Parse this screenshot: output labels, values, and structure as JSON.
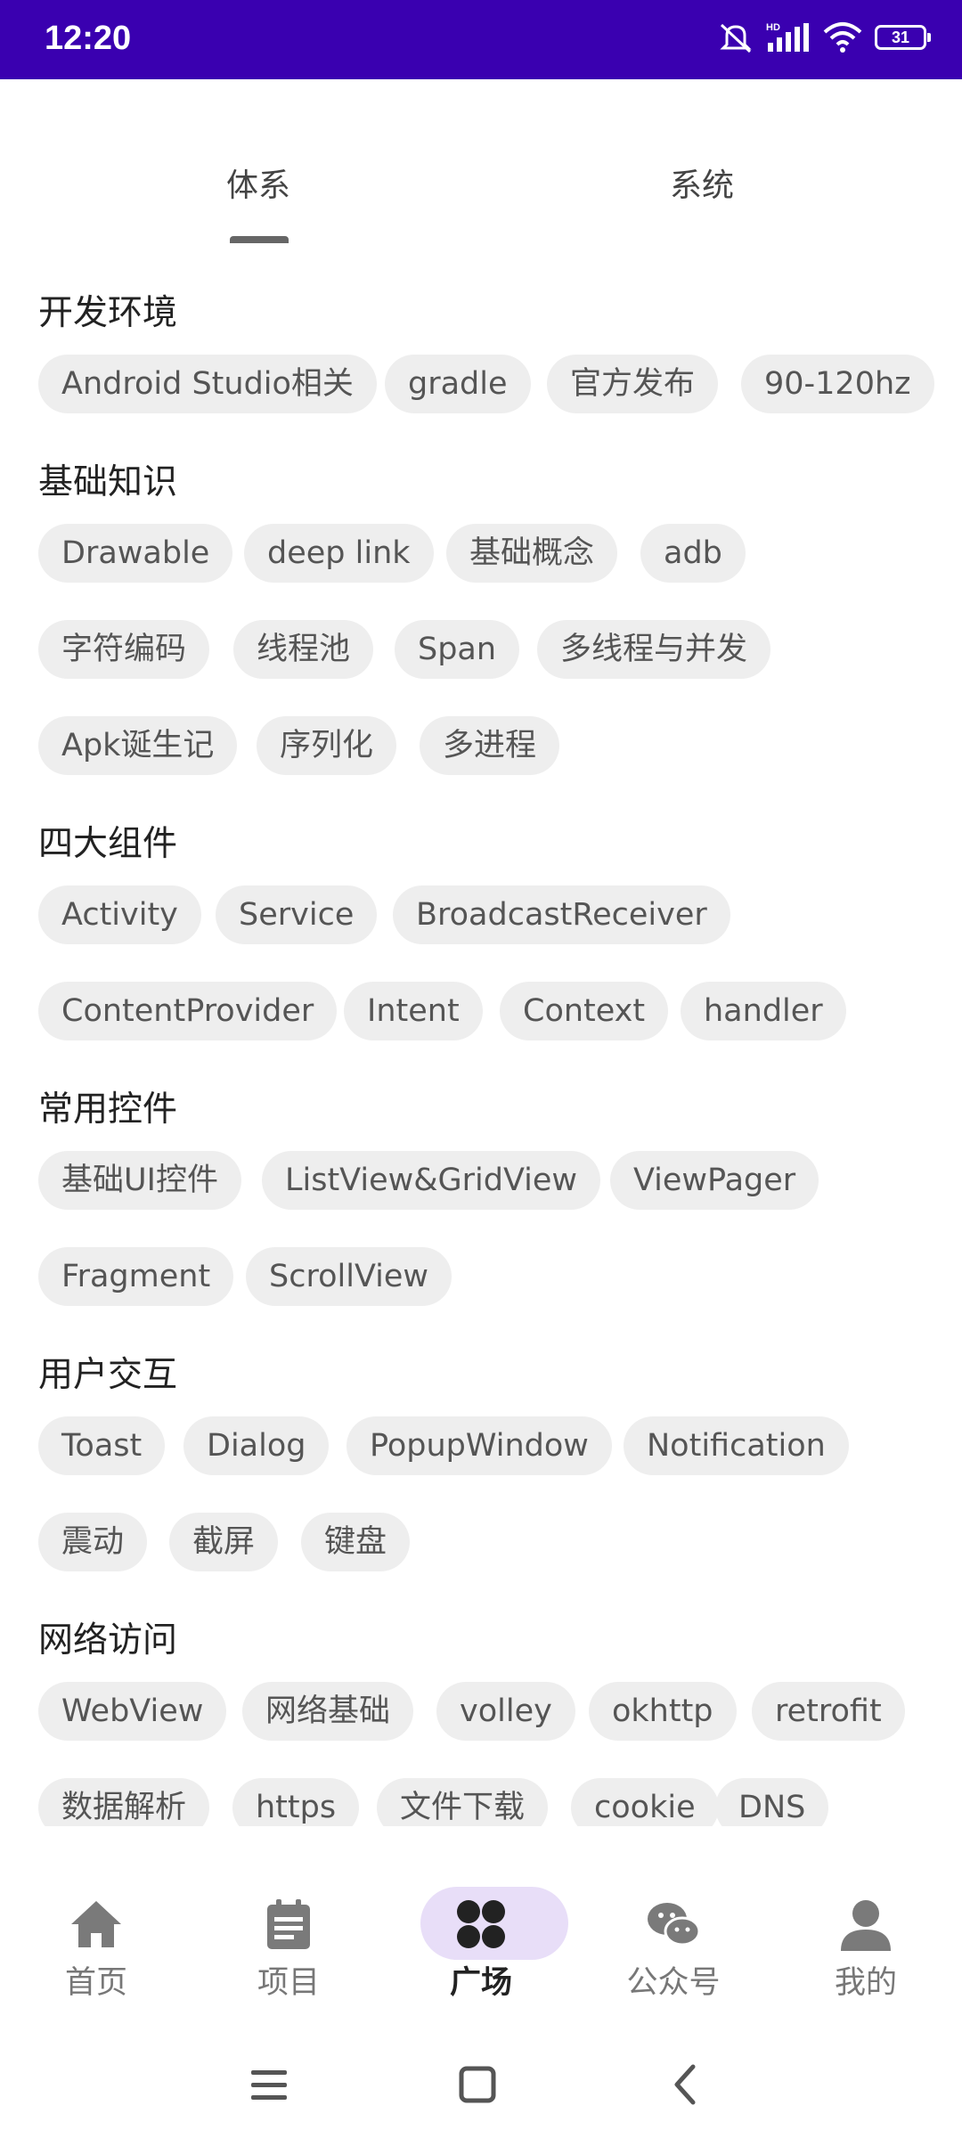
{
  "status": {
    "time": "12:20",
    "battery": "31"
  },
  "tabs": [
    {
      "label": "体系",
      "active": true
    },
    {
      "label": "系统",
      "active": false
    }
  ],
  "categories": [
    {
      "title": "开发环境",
      "chips": [
        "Android Studio相关",
        "gradle",
        "官方发布",
        "90-120hz"
      ]
    },
    {
      "title": "基础知识",
      "chips": [
        "Drawable",
        "deep link",
        "基础概念",
        "adb",
        "字符编码",
        "线程池",
        "Span",
        "多线程与并发",
        "Apk诞生记",
        "序列化",
        "多进程"
      ]
    },
    {
      "title": "四大组件",
      "chips": [
        "Activity",
        "Service",
        "BroadcastReceiver",
        "ContentProvider",
        "Intent",
        "Context",
        "handler"
      ]
    },
    {
      "title": "常用控件",
      "chips": [
        "基础UI控件",
        "ListView&GridView",
        "ViewPager",
        "Fragment",
        "ScrollView"
      ]
    },
    {
      "title": "用户交互",
      "chips": [
        "Toast",
        "Dialog",
        "PopupWindow",
        "Notification",
        "震动",
        "截屏",
        "键盘"
      ]
    },
    {
      "title": "网络访问",
      "chips": [
        "WebView",
        "网络基础",
        "volley",
        "okhttp",
        "retrofit",
        "数据解析",
        "https",
        "文件下载",
        "cookie",
        "DNS"
      ]
    }
  ],
  "bottom_nav": [
    {
      "label": "首页",
      "icon": "home-icon",
      "active": false
    },
    {
      "label": "项目",
      "icon": "clipboard-icon",
      "active": false
    },
    {
      "label": "广场",
      "icon": "grid-icon",
      "active": true
    },
    {
      "label": "公众号",
      "icon": "wechat-icon",
      "active": false
    },
    {
      "label": "我的",
      "icon": "person-icon",
      "active": false
    }
  ],
  "colors": {
    "status_bar": "#3a00b0",
    "chip_bg": "#eeeeee",
    "active_pill": "#e8def8"
  }
}
